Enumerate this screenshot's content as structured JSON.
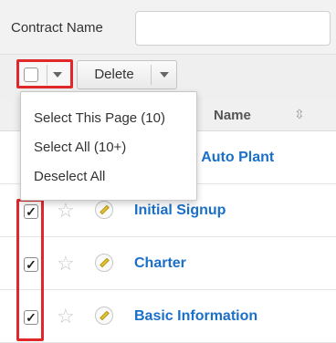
{
  "filter": {
    "label": "Contract Name",
    "value": "",
    "placeholder": ""
  },
  "actions": {
    "delete_label": "Delete"
  },
  "table": {
    "column_name": "Name",
    "rows": [
      {
        "name": "…nes for Auto Plant",
        "checked": false
      },
      {
        "name": "Initial Signup",
        "checked": true
      },
      {
        "name": "Charter",
        "checked": true
      },
      {
        "name": "Basic Information",
        "checked": true
      }
    ]
  },
  "dropdown": {
    "items": [
      "Select This Page (10)",
      "Select All (10+)",
      "Deselect All"
    ]
  },
  "colors": {
    "highlight": "#e0282b",
    "link": "#1a6fc9"
  },
  "icons": {
    "sort": "sort-icon",
    "favorite": "star-icon",
    "edit": "pencil-icon"
  }
}
